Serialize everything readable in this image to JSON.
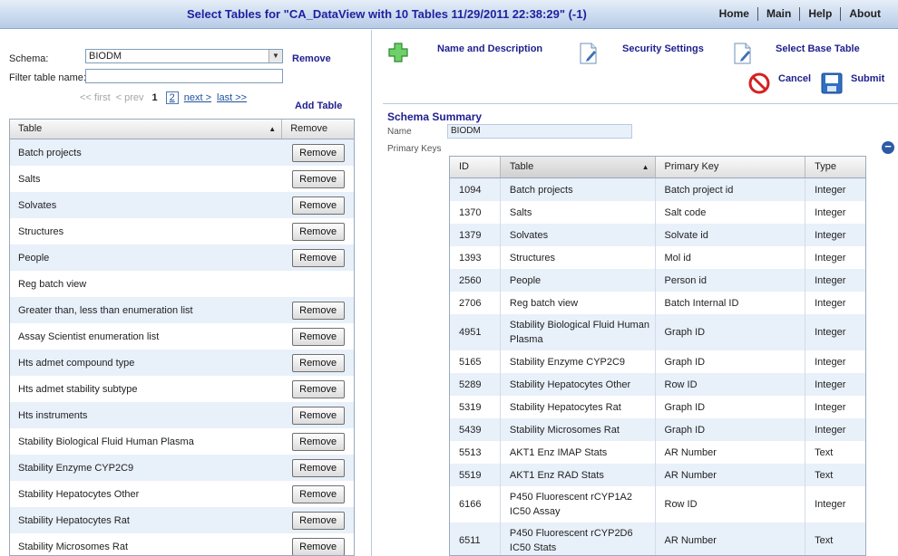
{
  "header": {
    "title": "Select Tables for \"CA_DataView with 10 Tables 11/29/2011 22:38:29\" (-1)",
    "nav": [
      "Home",
      "Main",
      "Help",
      "About"
    ]
  },
  "left": {
    "schema_label": "Schema:",
    "schema_value": "BIODM",
    "remove_link": "Remove",
    "filter_label": "Filter table name:",
    "filter_value": "",
    "pager": {
      "first": "<< first",
      "prev": "< prev",
      "current": "1",
      "page2": "2",
      "next": "next >",
      "last": "last >>"
    },
    "add_table": "Add Table",
    "table": {
      "col_table": "Table",
      "col_remove": "Remove",
      "button_label": "Remove",
      "rows": [
        {
          "name": "Batch projects",
          "removable": true
        },
        {
          "name": "Salts",
          "removable": true
        },
        {
          "name": "Solvates",
          "removable": true
        },
        {
          "name": "Structures",
          "removable": true
        },
        {
          "name": "People",
          "removable": true
        },
        {
          "name": "Reg batch view",
          "removable": false
        },
        {
          "name": "Greater than, less than enumeration list",
          "removable": true
        },
        {
          "name": "Assay Scientist enumeration list",
          "removable": true
        },
        {
          "name": "Hts admet compound type",
          "removable": true
        },
        {
          "name": "Hts admet stability subtype",
          "removable": true
        },
        {
          "name": "Hts instruments",
          "removable": true
        },
        {
          "name": "Stability Biological Fluid Human Plasma",
          "removable": true
        },
        {
          "name": "Stability Enzyme CYP2C9",
          "removable": true
        },
        {
          "name": "Stability Hepatocytes Other",
          "removable": true
        },
        {
          "name": "Stability Hepatocytes Rat",
          "removable": true
        },
        {
          "name": "Stability Microsomes Rat",
          "removable": true
        }
      ]
    }
  },
  "right": {
    "toolbar": {
      "name_desc": "Name and Description",
      "security": "Security Settings",
      "base_table": "Select Base Table",
      "cancel": "Cancel",
      "submit": "Submit"
    },
    "summary": {
      "title": "Schema Summary",
      "name_label": "Name",
      "name_value": "BIODM",
      "pk_label": "Primary Keys",
      "columns": [
        "ID",
        "Table",
        "Primary Key",
        "Type"
      ],
      "rows": [
        {
          "id": "1094",
          "table": "Batch projects",
          "pk": "Batch project id",
          "type": "Integer"
        },
        {
          "id": "1370",
          "table": "Salts",
          "pk": "Salt code",
          "type": "Integer"
        },
        {
          "id": "1379",
          "table": "Solvates",
          "pk": "Solvate id",
          "type": "Integer"
        },
        {
          "id": "1393",
          "table": "Structures",
          "pk": "Mol id",
          "type": "Integer"
        },
        {
          "id": "2560",
          "table": "People",
          "pk": "Person id",
          "type": "Integer"
        },
        {
          "id": "2706",
          "table": "Reg batch view",
          "pk": "Batch Internal ID",
          "type": "Integer"
        },
        {
          "id": "4951",
          "table": "Stability Biological Fluid Human Plasma",
          "pk": "Graph ID",
          "type": "Integer"
        },
        {
          "id": "5165",
          "table": "Stability Enzyme CYP2C9",
          "pk": "Graph ID",
          "type": "Integer"
        },
        {
          "id": "5289",
          "table": "Stability Hepatocytes Other",
          "pk": "Row ID",
          "type": "Integer"
        },
        {
          "id": "5319",
          "table": "Stability Hepatocytes Rat",
          "pk": "Graph ID",
          "type": "Integer"
        },
        {
          "id": "5439",
          "table": "Stability Microsomes Rat",
          "pk": "Graph ID",
          "type": "Integer"
        },
        {
          "id": "5513",
          "table": "AKT1 Enz IMAP Stats",
          "pk": "AR Number",
          "type": "Text"
        },
        {
          "id": "5519",
          "table": "AKT1 Enz RAD Stats",
          "pk": "AR Number",
          "type": "Text"
        },
        {
          "id": "6166",
          "table": "P450 Fluorescent rCYP1A2 IC50 Assay",
          "pk": "Row ID",
          "type": "Integer"
        },
        {
          "id": "6511",
          "table": "P450 Fluorescent rCYP2D6 IC50 Stats",
          "pk": "AR Number",
          "type": "Text"
        }
      ]
    }
  }
}
